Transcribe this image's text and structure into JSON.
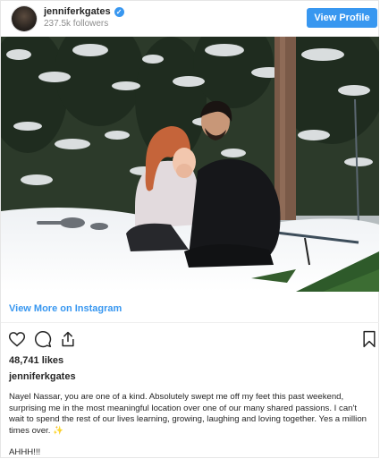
{
  "header": {
    "username": "jenniferkgates",
    "followers": "237.5k followers",
    "view_profile_label": "View Profile"
  },
  "post": {
    "image_alt": "Couple embracing in the snow in a forest",
    "view_more_label": "View More on Instagram",
    "likes": "48,741 likes",
    "author": "jenniferkgates",
    "caption": "Nayel Nassar, you are one of a kind. Absolutely swept me off my feet this past weekend, surprising me in the most meaningful location over one of our many shared passions. I can't wait to spend the rest of our lives learning, growing, laughing and loving together. Yes a million times over. ✨",
    "caption_end": "AHHH!!!"
  },
  "icons": {
    "verified": "verified-badge-icon",
    "like": "heart-icon",
    "comment": "comment-icon",
    "share": "share-icon",
    "save": "bookmark-icon"
  },
  "colors": {
    "accent": "#3897f0",
    "text": "#262626",
    "muted": "#8e8e8e"
  }
}
